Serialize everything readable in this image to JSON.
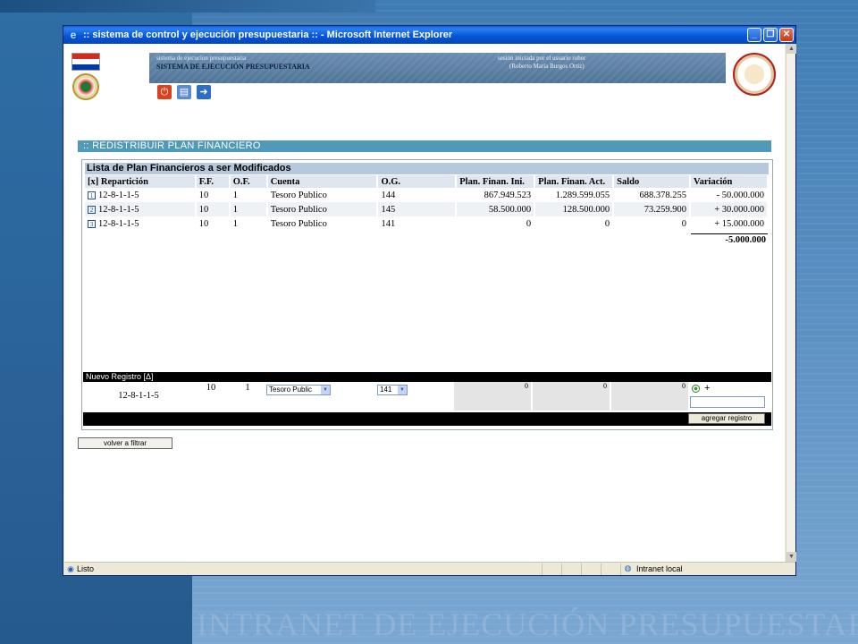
{
  "slide": {
    "bottom_banner": "INTRANET DE EJECUCIÓN PRESUPUESTARIA"
  },
  "window": {
    "title": ":: sistema de control y ejecución presupuestaria :: - Microsoft Internet Explorer"
  },
  "header": {
    "system_small": "sistema de ejecucion presupuestaria",
    "system_big": "SISTEMA DE EJECUCIÓN PRESUPUESTARIA",
    "session_line1": "sesión iniciada por el usuario rober",
    "session_line2": "(Roberto María Burgos Ortiz)"
  },
  "section_title": ":: REDISTRIBUIR PLAN FINANCIERO",
  "list": {
    "title": "Lista de Plan Financieros a ser Modificados",
    "columns": [
      "[x] Repartición",
      "F.F.",
      "O.F.",
      "Cuenta",
      "O.G.",
      "Plan. Finan. Ini.",
      "Plan. Finan. Act.",
      "Saldo",
      "Variación"
    ],
    "rows": [
      {
        "idx": "1",
        "reparticion": "12-8-1-1-5",
        "ff": "10",
        "of": "1",
        "cuenta": "Tesoro Publico",
        "og": "144",
        "ini": "867.949.523",
        "act": "1.289.599.055",
        "saldo": "688.378.255",
        "variacion": "- 50.000.000"
      },
      {
        "idx": "2",
        "reparticion": "12-8-1-1-5",
        "ff": "10",
        "of": "1",
        "cuenta": "Tesoro Publico",
        "og": "145",
        "ini": "58.500.000",
        "act": "128.500.000",
        "saldo": "73.259.900",
        "variacion": "+ 30.000.000"
      },
      {
        "idx": "3",
        "reparticion": "12-8-1-1-5",
        "ff": "10",
        "of": "1",
        "cuenta": "Tesoro Publico",
        "og": "141",
        "ini": "0",
        "act": "0",
        "saldo": "0",
        "variacion": "+ 15.000.000"
      }
    ],
    "total": "-5.000.000"
  },
  "new_record": {
    "title": "Nuevo Registro [Δ]",
    "reparticion": "12-8-1-1-5",
    "ff": "10",
    "of": "1",
    "cuenta_selected": "Tesoro Public",
    "og_selected": "141",
    "ini": "0",
    "act": "0",
    "saldo": "0",
    "sign": "+",
    "add_button": "agregar registro"
  },
  "back_button": "volver a filtrar",
  "status": {
    "left": "Listo",
    "zone": "Intranet local"
  },
  "colors": {
    "section_bar": "#4f9ab8",
    "list_header": "#b6c8dc",
    "titlebar": "#0454d8"
  }
}
